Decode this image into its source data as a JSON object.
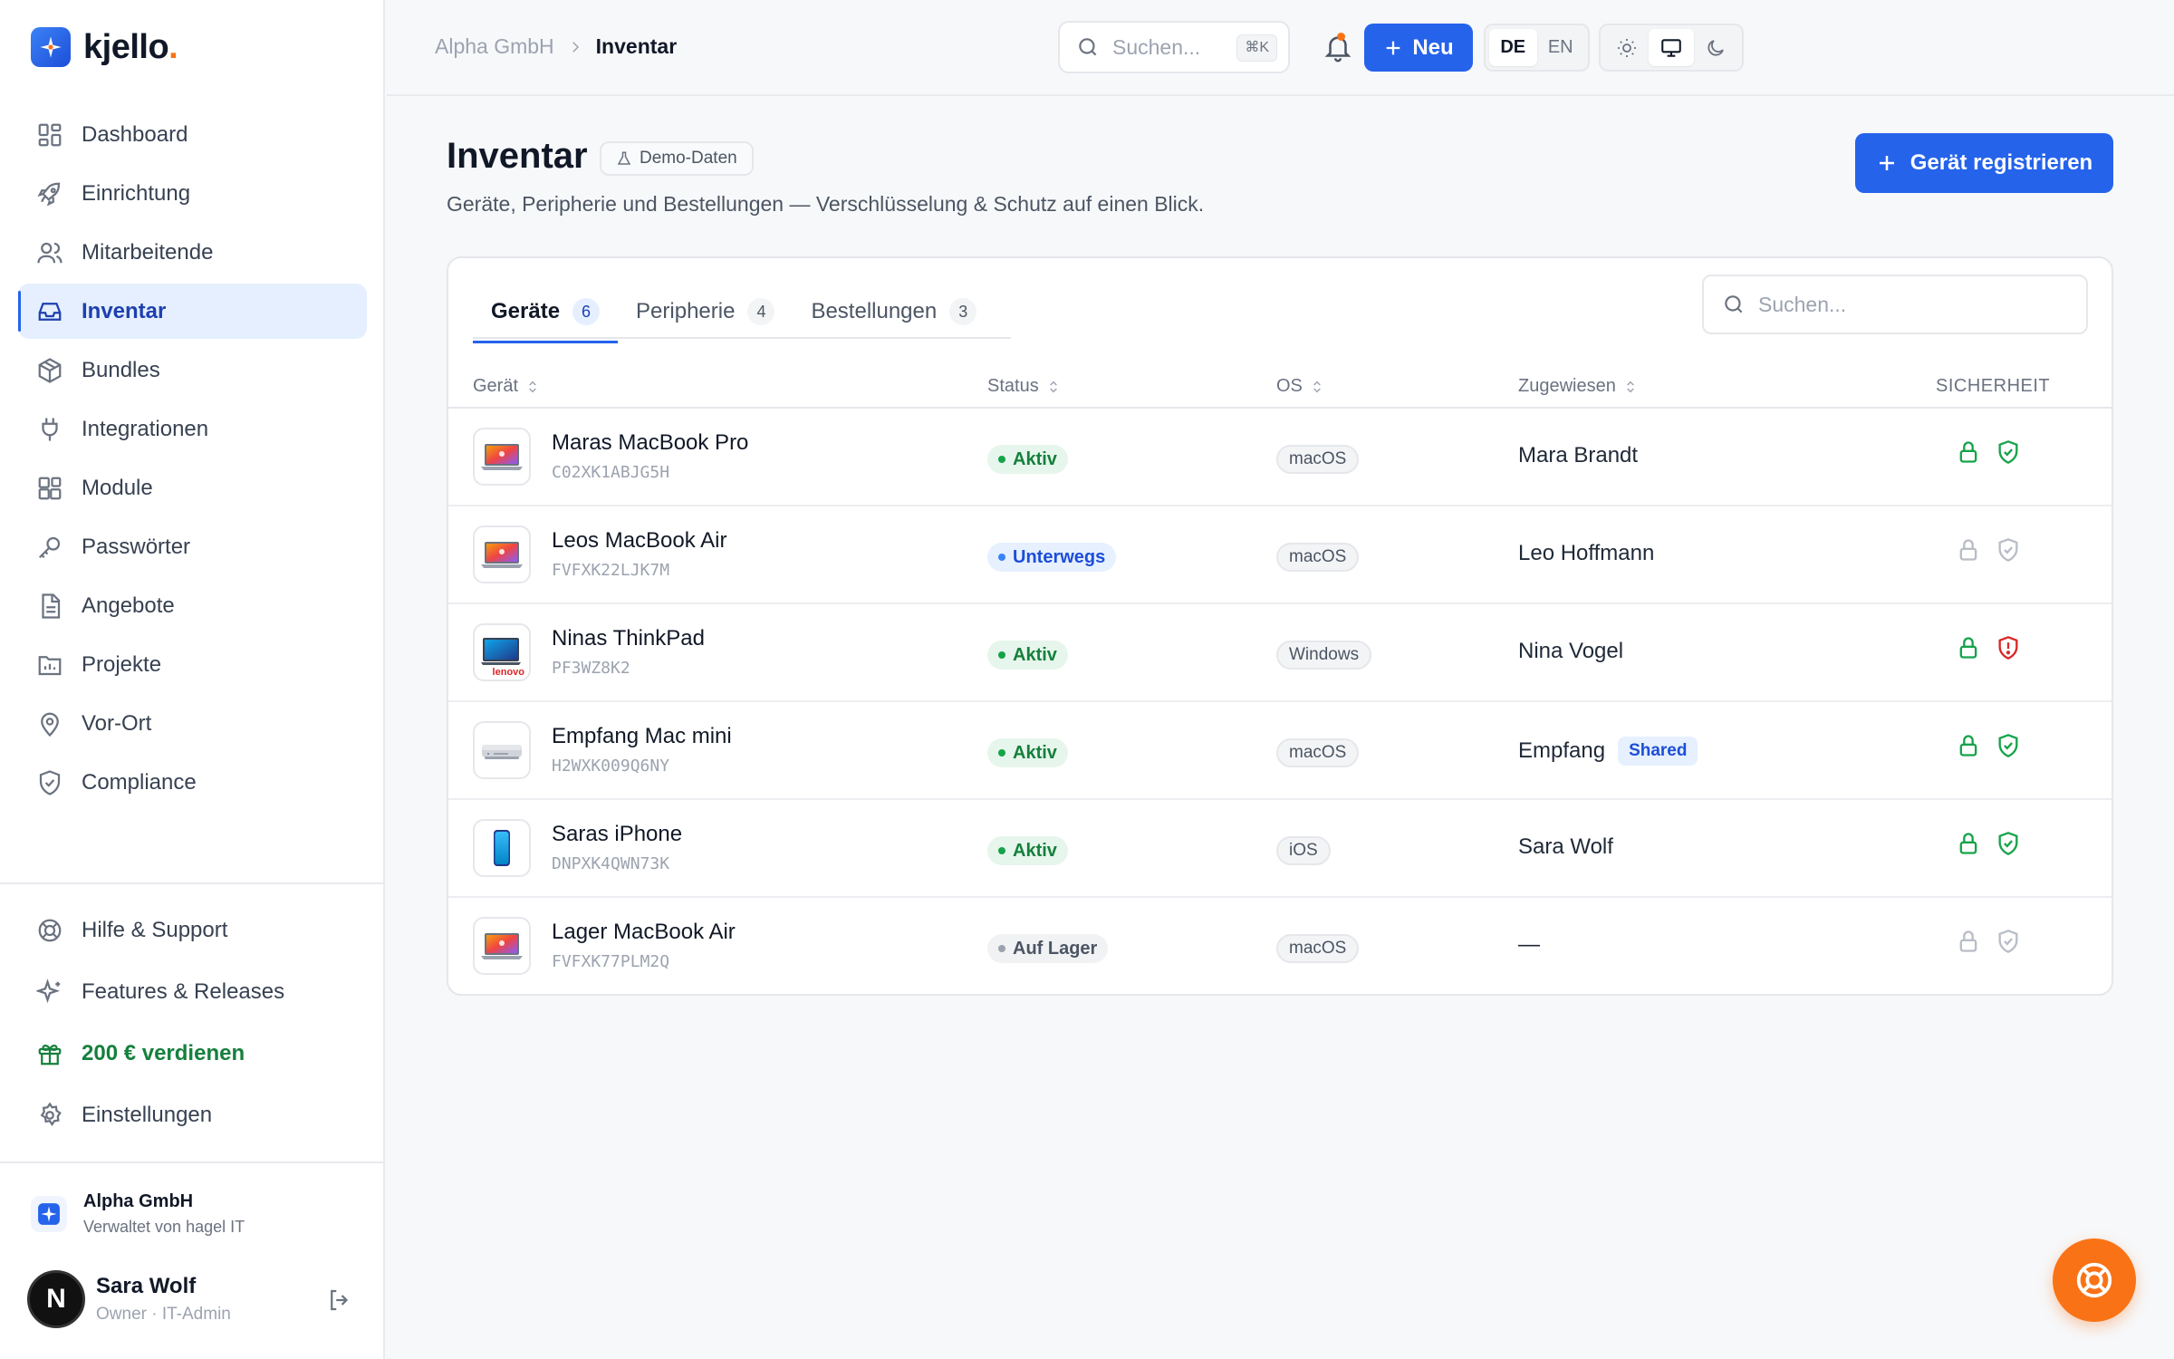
{
  "app": {
    "name": "kjello",
    "name_dot": "."
  },
  "sidebar": {
    "items": [
      {
        "label": "Dashboard",
        "icon": "dashboard-icon",
        "active": false
      },
      {
        "label": "Einrichtung",
        "icon": "rocket-icon",
        "active": false
      },
      {
        "label": "Mitarbeitende",
        "icon": "users-icon",
        "active": false
      },
      {
        "label": "Inventar",
        "icon": "inbox-icon",
        "active": true
      },
      {
        "label": "Bundles",
        "icon": "package-icon",
        "active": false
      },
      {
        "label": "Integrationen",
        "icon": "plug-icon",
        "active": false
      },
      {
        "label": "Module",
        "icon": "blocks-icon",
        "active": false
      },
      {
        "label": "Passwörter",
        "icon": "key-icon",
        "active": false
      },
      {
        "label": "Angebote",
        "icon": "document-icon",
        "active": false
      },
      {
        "label": "Projekte",
        "icon": "folder-chart-icon",
        "active": false
      },
      {
        "label": "Vor-Ort",
        "icon": "map-pin-icon",
        "active": false
      },
      {
        "label": "Compliance",
        "icon": "shield-check-icon",
        "active": false
      }
    ],
    "bottom_items": [
      {
        "label": "Hilfe & Support",
        "icon": "lifebuoy-icon"
      },
      {
        "label": "Features & Releases",
        "icon": "sparkles-icon"
      },
      {
        "label": "200 € verdienen",
        "icon": "gift-icon"
      },
      {
        "label": "Einstellungen",
        "icon": "gear-icon"
      }
    ],
    "org": {
      "name": "Alpha GmbH",
      "sub": "Verwaltet von hagel IT"
    },
    "user": {
      "initial": "N",
      "name": "Sara Wolf",
      "role": "Owner · IT-Admin"
    }
  },
  "topbar": {
    "breadcrumb": {
      "parent": "Alpha GmbH",
      "current": "Inventar"
    },
    "search": {
      "placeholder": "Suchen...",
      "shortcut": "⌘K"
    },
    "new_button": "Neu",
    "languages": [
      "DE",
      "EN"
    ],
    "active_language": "DE"
  },
  "page": {
    "title": "Inventar",
    "badge": "Demo-Daten",
    "subtitle": "Geräte, Peripherie und Bestellungen — Verschlüsselung & Schutz auf einen Blick.",
    "register_button": "Gerät registrieren"
  },
  "tabs": [
    {
      "label": "Geräte",
      "count": "6",
      "active": true
    },
    {
      "label": "Peripherie",
      "count": "4",
      "active": false
    },
    {
      "label": "Bestellungen",
      "count": "3",
      "active": false
    }
  ],
  "table": {
    "search_placeholder": "Suchen...",
    "columns": {
      "device": "Gerät",
      "status": "Status",
      "os": "OS",
      "assigned": "Zugewiesen",
      "security": "SICHERHEIT"
    },
    "rows": [
      {
        "name": "Maras MacBook Pro",
        "serial": "C02XK1ABJG5H",
        "status": "Aktiv",
        "os": "macOS",
        "assigned": "Mara Brandt",
        "shared": ""
      },
      {
        "name": "Leos MacBook Air",
        "serial": "FVFXK22LJK7M",
        "status": "Unterwegs",
        "os": "macOS",
        "assigned": "Leo Hoffmann",
        "shared": ""
      },
      {
        "name": "Ninas ThinkPad",
        "serial": "PF3WZ8K2",
        "status": "Aktiv",
        "os": "Windows",
        "assigned": "Nina Vogel",
        "shared": "",
        "brand": "lenovo"
      },
      {
        "name": "Empfang Mac mini",
        "serial": "H2WXK009Q6NY",
        "status": "Aktiv",
        "os": "macOS",
        "assigned": "Empfang",
        "shared": "Shared"
      },
      {
        "name": "Saras iPhone",
        "serial": "DNPXK4QWN73K",
        "status": "Aktiv",
        "os": "iOS",
        "assigned": "Sara Wolf",
        "shared": ""
      },
      {
        "name": "Lager MacBook Air",
        "serial": "FVFXK77PLM2Q",
        "status": "Auf Lager",
        "os": "macOS",
        "assigned": "—",
        "shared": ""
      }
    ]
  },
  "colors": {
    "accent": "#2563eb",
    "brand_orange": "#f97316",
    "success": "#16a34a",
    "danger": "#dc2626"
  }
}
